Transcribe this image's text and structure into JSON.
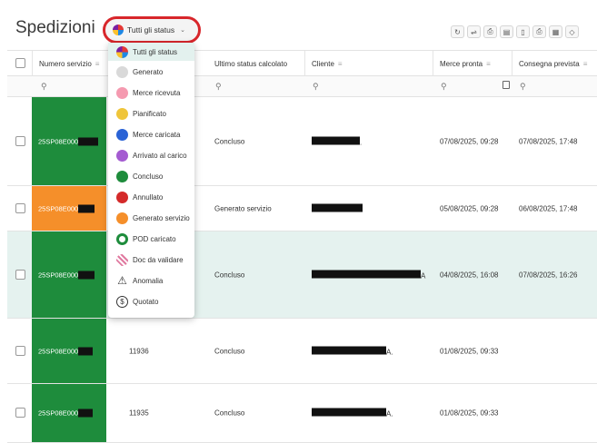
{
  "header": {
    "title": "Spedizioni",
    "filter_label": "Tutti gli status",
    "filter_chevron": "⌄",
    "tools": [
      {
        "icon": "refresh-icon",
        "glyph": "↻"
      },
      {
        "icon": "truck-icon",
        "glyph": "⇌"
      },
      {
        "icon": "printer-icon",
        "glyph": "⎙"
      },
      {
        "icon": "excel-icon",
        "glyph": "▤"
      },
      {
        "icon": "document-icon",
        "glyph": "▯"
      },
      {
        "icon": "print-doc-icon",
        "glyph": "⎙"
      },
      {
        "icon": "columns-icon",
        "glyph": "▦"
      },
      {
        "icon": "eraser-icon",
        "glyph": "◇"
      }
    ]
  },
  "columns": {
    "numero": "Numero servizio",
    "ultimo": "Ultimo status calcolato",
    "cliente": "Cliente",
    "merce": "Merce pronta",
    "consegna": "Consegna prevista",
    "filter_glyph": "≡",
    "search_glyph": "⚲"
  },
  "rows": [
    {
      "code": "25SP08E000",
      "id": "",
      "status": "Concluso",
      "merce": "07/08/2025, 09:28",
      "consegna": "07/08/2025, 17:48",
      "cliente_suffix": ".",
      "color": "#1e8c3c"
    },
    {
      "code": "25SP08E000",
      "id": "",
      "status": "Generato servizio",
      "merce": "05/08/2025, 09:28",
      "consegna": "06/08/2025, 17:48",
      "cliente_suffix": "",
      "color": "#f58f2a"
    },
    {
      "code": "25SP08E000",
      "id": "",
      "status": "Concluso",
      "merce": "04/08/2025, 16:08",
      "consegna": "07/08/2025, 16:26",
      "cliente_suffix": "A",
      "color": "#1e8c3c"
    },
    {
      "code": "25SP08E000",
      "id": "11936",
      "status": "Concluso",
      "merce": "01/08/2025, 09:33",
      "consegna": "",
      "cliente_suffix": "A.",
      "color": "#1e8c3c"
    },
    {
      "code": "25SP08E000",
      "id": "11935",
      "status": "Concluso",
      "merce": "01/08/2025, 09:33",
      "consegna": "",
      "cliente_suffix": "A.",
      "color": "#1e8c3c"
    }
  ],
  "dropdown": [
    {
      "label": "Tutti gli status",
      "icon": "all-status-wheel-icon",
      "color": "#e53935"
    },
    {
      "label": "Generato",
      "icon": "generato-dot-icon",
      "color": "#d9d9d9"
    },
    {
      "label": "Merce ricevuta",
      "icon": "merce-ricevuta-dot-icon",
      "color": "#f59ab0"
    },
    {
      "label": "Pianificato",
      "icon": "pianificato-dot-icon",
      "color": "#efc53a"
    },
    {
      "label": "Merce caricata",
      "icon": "merce-caricata-dot-icon",
      "color": "#2a63d6"
    },
    {
      "label": "Arrivato al carico",
      "icon": "arrivato-dot-icon",
      "color": "#a45bd1"
    },
    {
      "label": "Concluso",
      "icon": "concluso-dot-icon",
      "color": "#1e8c3c"
    },
    {
      "label": "Annullato",
      "icon": "annullato-dot-icon",
      "color": "#d42a2a"
    },
    {
      "label": "Generato servizio",
      "icon": "generato-servizio-dot-icon",
      "color": "#f58f2a"
    },
    {
      "label": "POD caricato",
      "icon": "pod-ring-icon",
      "color": "#1e8c3c"
    },
    {
      "label": "Doc da validare",
      "icon": "striped-dot-icon",
      "color": "#e07aa0"
    },
    {
      "label": "Anomalia",
      "icon": "warning-icon",
      "color": "#333333"
    },
    {
      "label": "Quotato",
      "icon": "dollar-icon",
      "color": "#333333"
    }
  ]
}
